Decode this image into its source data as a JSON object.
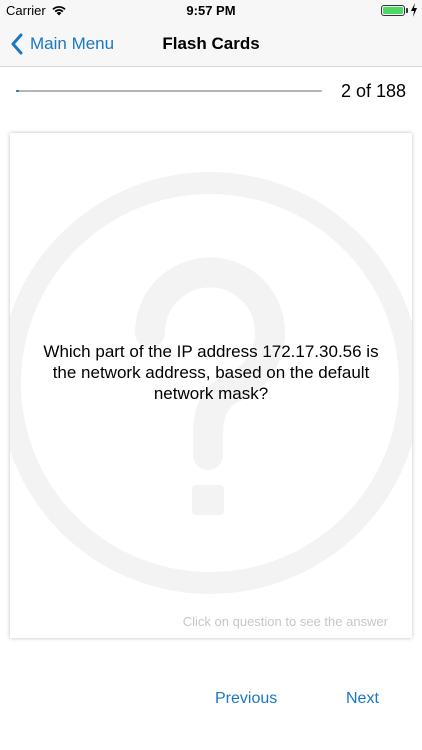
{
  "status_bar": {
    "carrier": "Carrier",
    "time": "9:57 PM",
    "battery_level": 1.0
  },
  "nav": {
    "back_label": "Main Menu",
    "title": "Flash Cards"
  },
  "progress": {
    "current": 2,
    "total": 188,
    "text": "2 of 188"
  },
  "card": {
    "question": "Which part of the IP address 172.17.30.56 is the network address, based on the default network mask?",
    "hint": "Click on question to see the answer",
    "watermark_icon": "question-circle-icon"
  },
  "buttons": {
    "previous_label": "Previous",
    "next_label": "Next"
  },
  "colors": {
    "accent": "#1a78c2",
    "hint_text": "#c7c7c7",
    "battery": "#4cd964"
  }
}
